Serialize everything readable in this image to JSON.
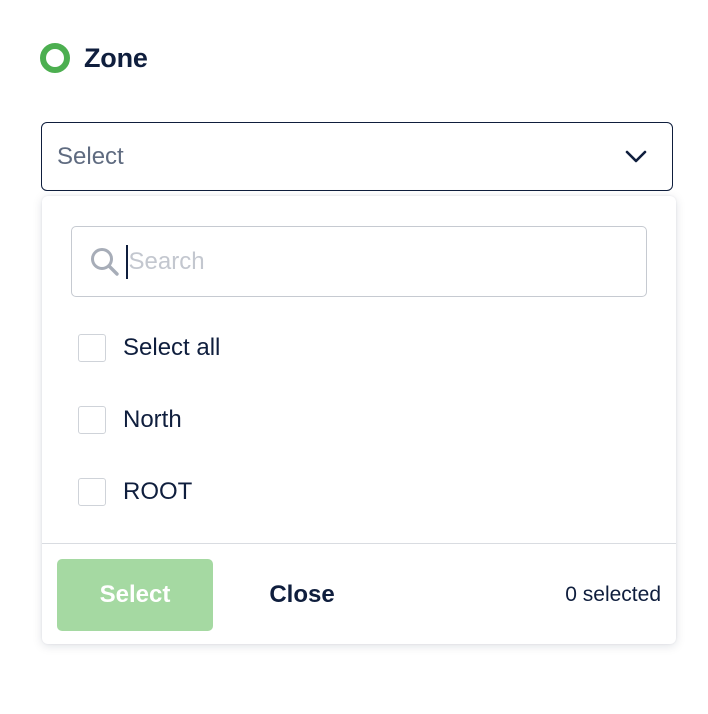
{
  "header": {
    "title": "Zone",
    "status_color": "#4caf50",
    "status_icon": "status-dot-icon"
  },
  "select": {
    "placeholder": "Select",
    "chevron_icon": "chevron-down-icon"
  },
  "dropdown": {
    "search": {
      "placeholder": "Search",
      "value": "",
      "icon": "search-icon"
    },
    "options": [
      {
        "label": "Select all",
        "checked": false
      },
      {
        "label": "North",
        "checked": false
      },
      {
        "label": "ROOT",
        "checked": false
      }
    ],
    "footer": {
      "select_label": "Select",
      "close_label": "Close",
      "selected_count_text": "0 selected",
      "select_button_color": "#a5d9a2"
    }
  }
}
